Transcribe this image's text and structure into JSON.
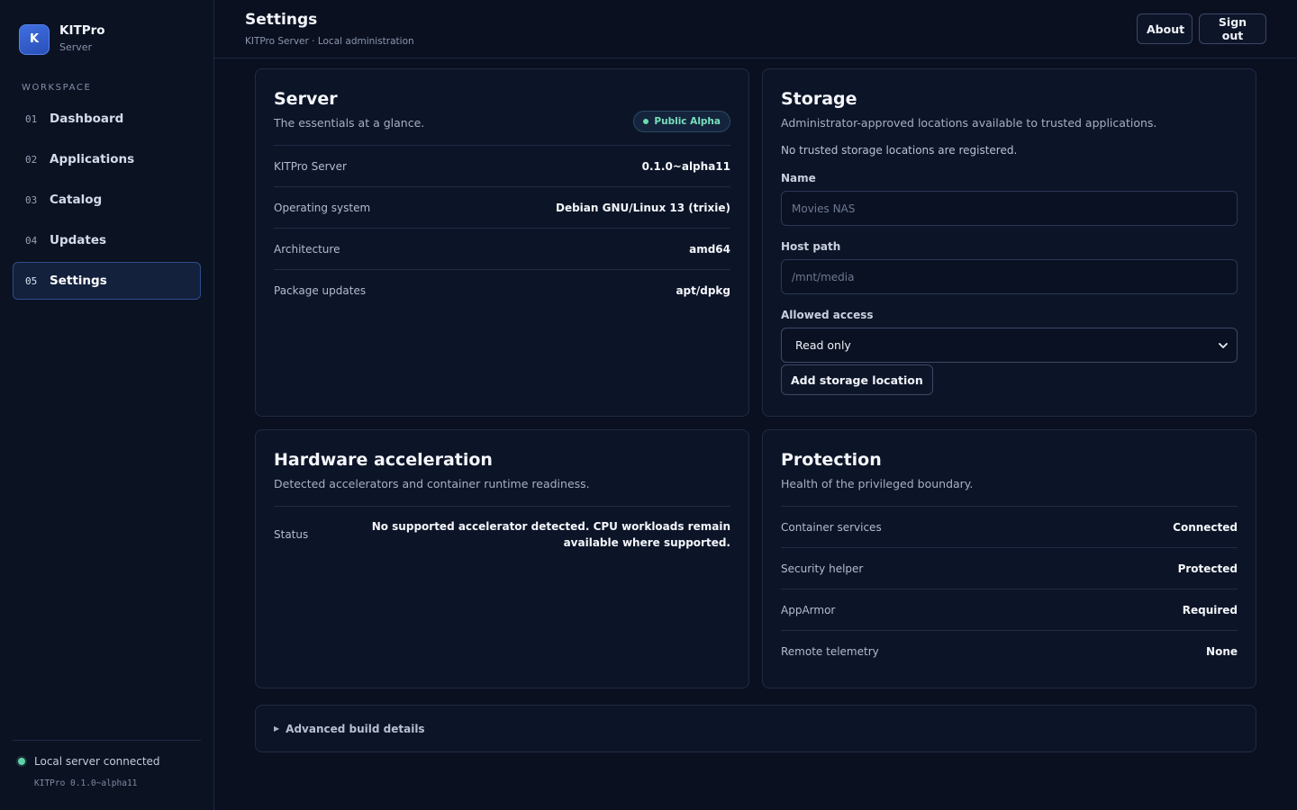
{
  "brand": {
    "logo_letter": "K",
    "name": "KITPro",
    "subtitle": "Server"
  },
  "sidebar": {
    "section_label": "WORKSPACE",
    "items": [
      {
        "num": "01",
        "label": "Dashboard"
      },
      {
        "num": "02",
        "label": "Applications"
      },
      {
        "num": "03",
        "label": "Catalog"
      },
      {
        "num": "04",
        "label": "Updates"
      },
      {
        "num": "05",
        "label": "Settings",
        "active": true
      }
    ],
    "footer": {
      "status": "Local server connected",
      "version": "KITPro 0.1.0~alpha11"
    }
  },
  "header": {
    "title": "Settings",
    "subtitle": "KITPro Server · Local administration",
    "about_label": "About",
    "signout_label": "Sign out"
  },
  "server": {
    "title": "Server",
    "desc": "The essentials at a glance.",
    "badge": "Public Alpha",
    "rows": [
      {
        "key": "KITPro Server",
        "value": "0.1.0~alpha11"
      },
      {
        "key": "Operating system",
        "value": "Debian GNU/Linux 13 (trixie)"
      },
      {
        "key": "Architecture",
        "value": "amd64"
      },
      {
        "key": "Package updates",
        "value": "apt/dpkg"
      }
    ]
  },
  "storage": {
    "title": "Storage",
    "desc": "Administrator-approved locations available to trusted applications.",
    "empty_note": "No trusted storage locations are registered.",
    "name_label": "Name",
    "name_placeholder": "Movies NAS",
    "path_label": "Host path",
    "path_placeholder": "/mnt/media",
    "access_label": "Allowed access",
    "access_value": "Read only",
    "add_label": "Add storage location"
  },
  "hardware": {
    "title": "Hardware acceleration",
    "desc": "Detected accelerators and container runtime readiness.",
    "status_key": "Status",
    "status_value": "No supported accelerator detected. CPU workloads remain available where supported."
  },
  "protection": {
    "title": "Protection",
    "desc": "Health of the privileged boundary.",
    "rows": [
      {
        "key": "Container services",
        "value": "Connected"
      },
      {
        "key": "Security helper",
        "value": "Protected"
      },
      {
        "key": "AppArmor",
        "value": "Required"
      },
      {
        "key": "Remote telemetry",
        "value": "None"
      }
    ]
  },
  "advanced": {
    "label": "Advanced build details"
  },
  "colors": {
    "accent": "#3f6fe0",
    "success": "#5fd3a7",
    "background": "#0a1020",
    "card": "#0c1427"
  }
}
